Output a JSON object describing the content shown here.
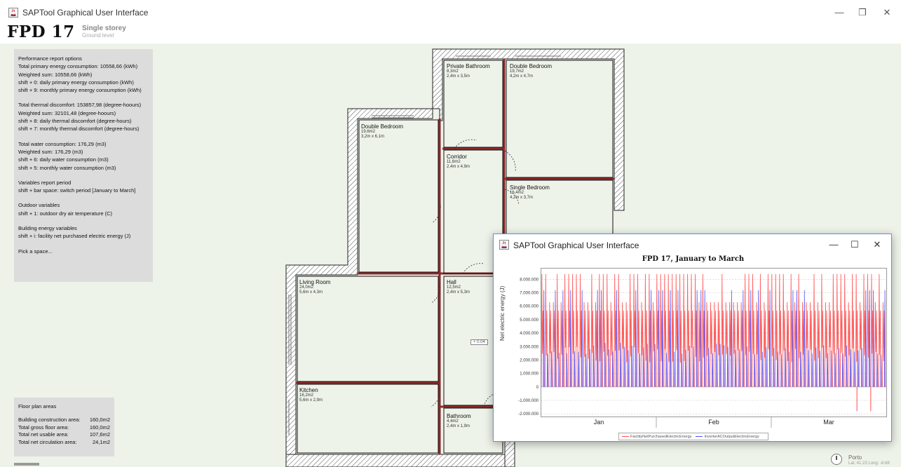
{
  "window": {
    "title": "SAPTool Graphical User Interface",
    "minimize": "—",
    "maximize": "❐",
    "close": "✕"
  },
  "header": {
    "title": "FPD 17",
    "storey": "Single storey",
    "level": "Ground level"
  },
  "report": {
    "lines_1": [
      "Performance report options",
      "Total primary energy consumption: 10558,66 (kWh)",
      "Weighted sum: 10558,66 (kWh)",
      "shift + 0: daily primary energy consumption (kWh)",
      "shift + 9: monthly primary energy consumption (kWh)"
    ],
    "lines_2": [
      "Total thermal discomfort: 153857,98 (degree-hoours)",
      "Weighted sum: 32101,48 (degree-hoours)",
      "shift + 8: daily thermal discomfort (degree-hours)",
      "shift + 7: monthly thermal discomfort (degree-hours)"
    ],
    "lines_3": [
      "Total water consumption: 176,29 (m3)",
      "Weighted sum: 176,29 (m3)",
      "shift + 6: daily water consumption (m3)",
      "shift + 5: monthly water consumption (m3)"
    ],
    "lines_4": [
      "Variables report period",
      "shift + bar space: switch period [January to March]"
    ],
    "lines_5": [
      "Outdoor variables",
      "shift + 1: outdoor dry air temperature (C)"
    ],
    "lines_6": [
      "Building energy variables",
      "shift + i: facility net purchased electric energy (J)"
    ],
    "lines_7": [
      "Pick a space..."
    ]
  },
  "areas": {
    "title": "Floor plan areas",
    "rows": [
      {
        "label": "Building construction area:",
        "value": "160,0m2"
      },
      {
        "label": "Total gross floor area:",
        "value": "160,0m2"
      },
      {
        "label": "Total net usable area:",
        "value": "107,6m2"
      },
      {
        "label": "Total net circulation area:",
        "value": "24,1m2"
      }
    ]
  },
  "location": {
    "city": "Porto",
    "coords": "Lat: 41.23 Long: -8.68"
  },
  "rooms": {
    "private_bathroom": {
      "name": "Private Bathroom",
      "area": "8,3m2",
      "dims": "2,4m x 3,5m"
    },
    "double_bedroom_1": {
      "name": "Double Bedroom",
      "area": "19,7m2",
      "dims": "4,2m x 4,7m"
    },
    "double_bedroom_2": {
      "name": "Double Bedroom",
      "area": "19,6m2",
      "dims": "3,2m x 6,1m"
    },
    "corridor": {
      "name": "Corridor",
      "area": "11,6m2",
      "dims": "2,4m x 4,9m"
    },
    "single_bedroom": {
      "name": "Single Bedroom",
      "area": "16,4m2",
      "dims": "4,2m x 3,7m"
    },
    "living_room": {
      "name": "Living Room",
      "area": "24,0m2",
      "dims": "5,6m x 4,3m"
    },
    "hall": {
      "name": "Hall",
      "area": "12,5m2",
      "dims": "2,4m x 5,3m"
    },
    "kitchen": {
      "name": "Kitchen",
      "area": "16,2m2",
      "dims": "5,6m x 2,9m"
    },
    "bathroom": {
      "name": "Bathroom",
      "area": "4,4m2",
      "dims": "2,4m x 1,9m"
    },
    "level_tag": "+ 0.04"
  },
  "chart_window": {
    "title": "SAPTool Graphical User Interface",
    "minimize": "—",
    "maximize": "☐",
    "close": "✕"
  },
  "chart_data": {
    "type": "line",
    "title": "FPD 17, January to March",
    "xlabel": "",
    "ylabel": "Net electric energy (J)",
    "categories": [
      "Jan",
      "Feb",
      "Mar"
    ],
    "ylim": [
      -2200000,
      8800000
    ],
    "yticks": [
      "8.000.000",
      "7.000.000",
      "6.000.000",
      "5.000.000",
      "4.000.000",
      "3.000.000",
      "2.000.000",
      "1.000.000",
      "0",
      "-1.000.000",
      "-2.000.000"
    ],
    "ytick_values": [
      8000000,
      7000000,
      6000000,
      5000000,
      4000000,
      3000000,
      2000000,
      1000000,
      0,
      -1000000,
      -2000000
    ],
    "legend_position": "bottom",
    "grid": true,
    "series": [
      {
        "name": "FacilityNetPurchasedElectricEnergy",
        "color": "#ff4d4d",
        "peak": 8400000,
        "typical_high": 6300000,
        "typical_low": 0,
        "min": -1800000
      },
      {
        "name": "InverterACOutputElectricEnergy",
        "color": "#4d4dff",
        "peak": 8400000,
        "typical_high": 7200000,
        "typical_low": 0,
        "min": 0
      }
    ]
  }
}
